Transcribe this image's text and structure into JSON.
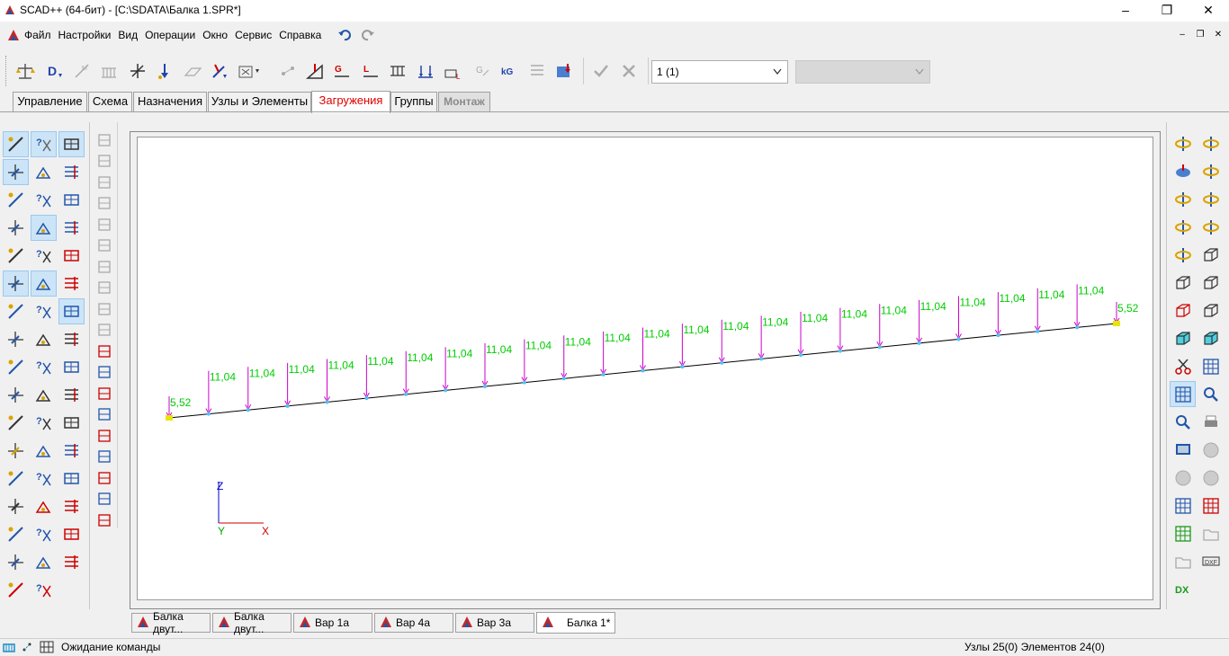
{
  "window": {
    "title": "SCAD++ (64-бит) - [C:\\SDATA\\Балка 1.SPR*]",
    "minimize": "–",
    "maximize": "❐",
    "close": "✕"
  },
  "menu": [
    "Файл",
    "Настройки",
    "Вид",
    "Операции",
    "Окно",
    "Сервис",
    "Справка"
  ],
  "mdi_controls": [
    "–",
    "❐",
    "✕"
  ],
  "toolbar": {
    "load_case_select": "1 (1)",
    "second_select": ""
  },
  "tabs": [
    {
      "label": "Управление",
      "state": "normal"
    },
    {
      "label": "Схема",
      "state": "normal"
    },
    {
      "label": "Назначения",
      "state": "normal"
    },
    {
      "label": "Узлы и Элементы",
      "state": "normal"
    },
    {
      "label": "Загружения",
      "state": "active"
    },
    {
      "label": "Группы",
      "state": "normal"
    },
    {
      "label": "Монтаж",
      "state": "disabled"
    }
  ],
  "canvas": {
    "load_labels": [
      "5,52",
      "11,04",
      "11,04",
      "11,04",
      "11,04",
      "11,04",
      "11,04",
      "11,04",
      "11,04",
      "11,04",
      "11,04",
      "11,04",
      "11,04",
      "11,04",
      "11,04",
      "11,04",
      "11,04",
      "11,04",
      "11,04",
      "11,04",
      "11,04",
      "11,04",
      "11,04",
      "11,04",
      "5,52"
    ],
    "axis_labels": {
      "z": "Z",
      "y": "Y",
      "x": "X"
    },
    "colors": {
      "load_arrow": "#cc00cc",
      "load_text": "#00cc00",
      "beam": "#000000",
      "node": "#4fc3f7",
      "support": "#e6e600"
    }
  },
  "doc_tabs": [
    {
      "label": "Балка двут...",
      "active": false
    },
    {
      "label": "Балка двут...",
      "active": false
    },
    {
      "label": "Вар 1а",
      "active": false
    },
    {
      "label": "Вар 4а",
      "active": false
    },
    {
      "label": "Вар 3а",
      "active": false
    },
    {
      "label": "Балка 1*",
      "active": true
    }
  ],
  "status": {
    "message": "Ожидание команды",
    "counts": "Узлы 25(0) Элементов 24(0)"
  },
  "icons": {
    "left_palette": [
      "pencil-icon",
      "eraser-icon",
      "cube-face-icon",
      "spring-query-icon",
      "query-info-icon",
      "query-cross-icon",
      "query-ne-icon",
      "query-nj-icon",
      "query-te-icon",
      "query-r-icon",
      "query-support-icon",
      "query-grid-icon",
      "cross-node-icon",
      "cross-node2-icon",
      "doc-plus-icon",
      "beam-load-icon",
      "beam-arrow-icon",
      "triangle-icon",
      "frame-load-icon",
      "query-arrow-icon",
      "query-force-icon",
      "multi-arrow-icon",
      "cross-arrows-icon",
      "cross-arrows2-icon",
      "diagonal-icon",
      "grid-color-icon",
      "grid-gray-icon",
      "grid-dots-icon",
      "plate-icon",
      "cube-icon",
      "column-load-icon",
      "cube-outline-icon",
      "brush-icon",
      "stack-icon",
      "query-nodes-icon",
      "query-n-icon",
      "query-g-icon",
      "query-g2-icon",
      "query-l-icon",
      "table-icon",
      "red-table-icon",
      "chart-icon",
      "color-grid-icon",
      "t-profile-icon",
      "box-profile-icon",
      "layers-icon",
      "layers2-icon",
      "sum-icon",
      "sum-arrows-icon",
      "force-arrow-icon"
    ],
    "right_palette": [
      "rotate-view-icon",
      "rotate-3d-icon",
      "disk-rotate-icon",
      "rotate-x-icon",
      "rotate-x2-icon",
      "rotate-z-icon",
      "rotate-z2-icon",
      "rotate-y-icon",
      "rotate-y2-icon",
      "box-3d-icon",
      "box-front-icon",
      "box-side-icon",
      "box-red-icon",
      "box-top-icon",
      "box-cyan-icon",
      "box-cyan2-icon",
      "scissors-icon",
      "grid-view-icon",
      "grid-view2-icon",
      "zoom-icon",
      "zoom-off-icon",
      "print-icon",
      "screen-icon",
      "wheel-icon",
      "circle-icon",
      "circle2-icon",
      "grid-blue-icon",
      "grid-red-icon",
      "grid-green-icon",
      "folder-icon",
      "folder2-icon",
      "dxf-icon",
      "dx-icon"
    ]
  }
}
